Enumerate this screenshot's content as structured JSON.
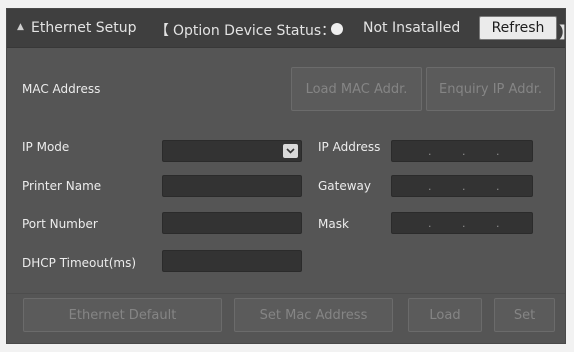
{
  "header": {
    "title": "Ethernet Setup",
    "bracket_open": "【",
    "status_label": "Option Device Status：",
    "status_value": "Not Insatalled",
    "refresh_label": "Refresh",
    "bracket_close": "】",
    "collapse_icon": "▲"
  },
  "mac": {
    "label": "MAC Address",
    "load_mac_label": "Load MAC Addr.",
    "enquiry_ip_label": "Enquiry IP Addr."
  },
  "form": {
    "ip_mode_label": "IP Mode",
    "ip_mode_value": "",
    "printer_name_label": "Printer Name",
    "printer_name_value": "",
    "port_number_label": "Port Number",
    "port_number_value": "",
    "dhcp_timeout_label": "DHCP Timeout(ms)",
    "dhcp_timeout_value": "",
    "ip_address_label": "IP Address",
    "gateway_label": "Gateway",
    "mask_label": "Mask",
    "ip_separator": "."
  },
  "footer": {
    "ethernet_default_label": "Ethernet Default",
    "set_mac_label": "Set Mac Address",
    "load_label": "Load",
    "set_label": "Set"
  },
  "colors": {
    "panel_bg": "#555555",
    "header_bg": "#3f3f3f",
    "field_bg": "#333333"
  }
}
